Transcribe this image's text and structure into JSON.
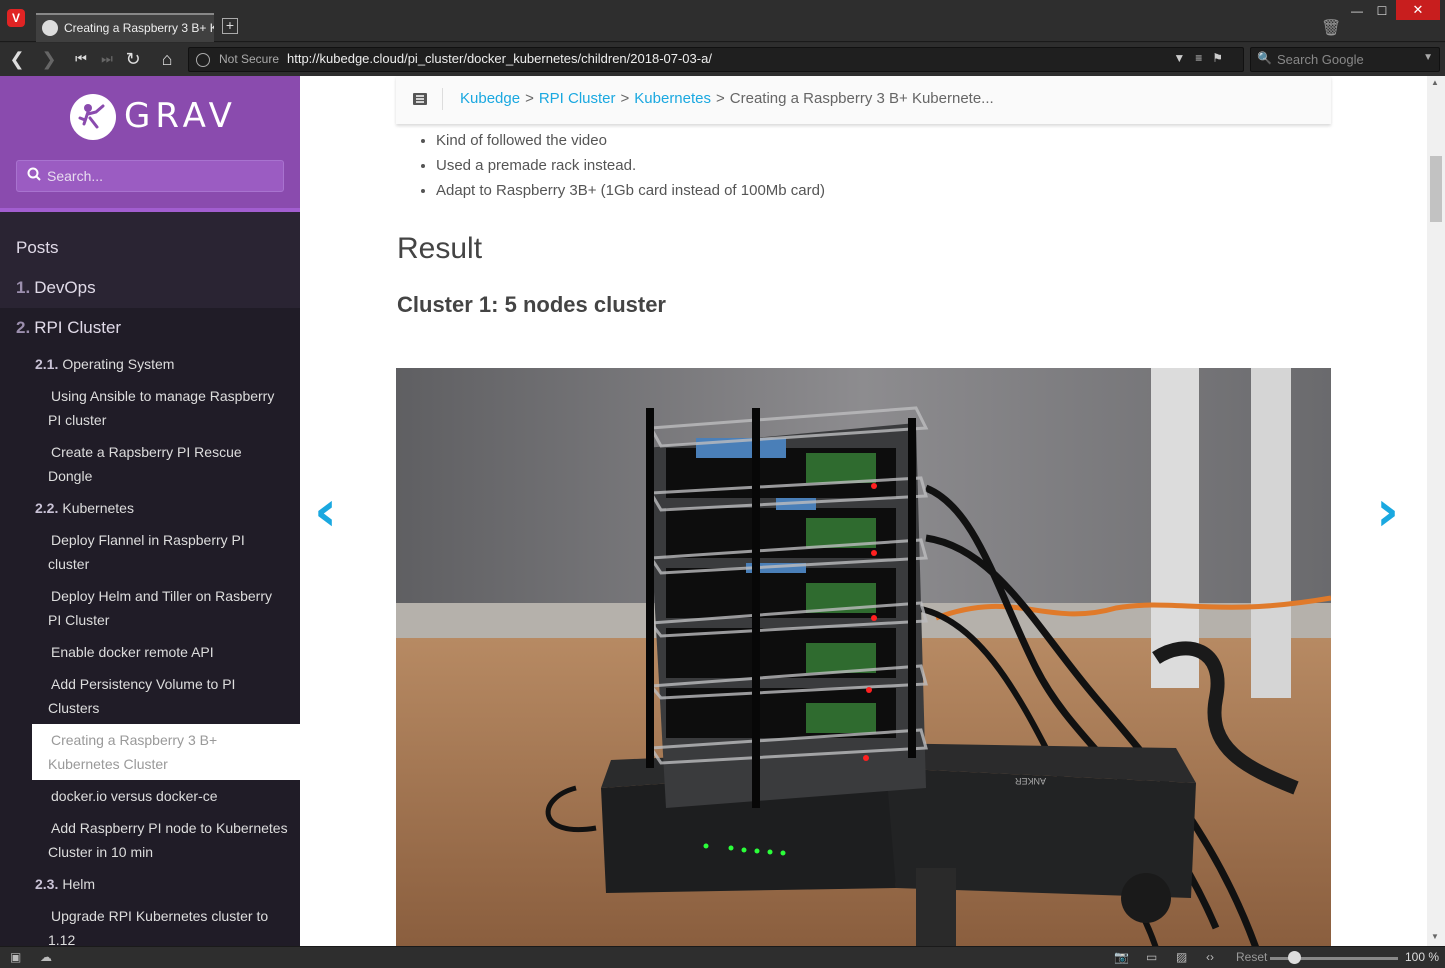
{
  "browser": {
    "tab_title": "Creating a Raspberry 3 B+ K",
    "security_label": "Not Secure",
    "url": "http://kubedge.cloud/pi_cluster/docker_kubernetes/children/2018-07-03-a/",
    "search_placeholder": "Search Google",
    "zoom_reset_label": "Reset",
    "zoom_level": "100 %"
  },
  "sidebar": {
    "logo_text": "GRAV",
    "search_placeholder": "Search...",
    "level1": [
      {
        "num": "",
        "label": "Posts"
      },
      {
        "num": "1.",
        "label": "DevOps"
      },
      {
        "num": "2.",
        "label": "RPI Cluster"
      }
    ],
    "sections": [
      {
        "num": "2.1.",
        "label": "Operating System"
      },
      {
        "num": "2.2.",
        "label": "Kubernetes"
      },
      {
        "num": "2.3.",
        "label": "Helm"
      }
    ],
    "pages": [
      "Using Ansible to manage Raspberry PI cluster",
      "Create a Rapsberry PI Rescue Dongle",
      "Deploy Flannel in Raspberry PI cluster",
      "Deploy Helm and Tiller on Rasberry PI Cluster",
      "Enable docker remote API",
      "Add Persistency Volume to PI Clusters",
      "Creating a Raspberry 3 B+ Kubernetes Cluster",
      "docker.io versus docker-ce",
      "Add Raspberry PI node to Kubernetes Cluster in 10 min",
      "Upgrade RPI Kubernetes cluster to 1.12"
    ]
  },
  "breadcrumb": {
    "items": [
      "Kubedge",
      "RPI Cluster",
      "Kubernetes"
    ],
    "separator": ">",
    "current": "Creating a Raspberry 3 B+ Kubernete..."
  },
  "content": {
    "bullets": [
      "Kind of followed the video",
      "Used a premade rack instead.",
      "Adapt to Raspberry 3B+ (1Gb card instead of 100Mb card)"
    ],
    "result_heading": "Result",
    "cluster_bold": "Cluster 1",
    "cluster_rest": ": 5 nodes cluster",
    "photo_label": "ANKER"
  },
  "colors": {
    "accent": "#1aa8e0",
    "sidebar_header": "#8a4bae",
    "sidebar_bg": "#2a2433"
  }
}
